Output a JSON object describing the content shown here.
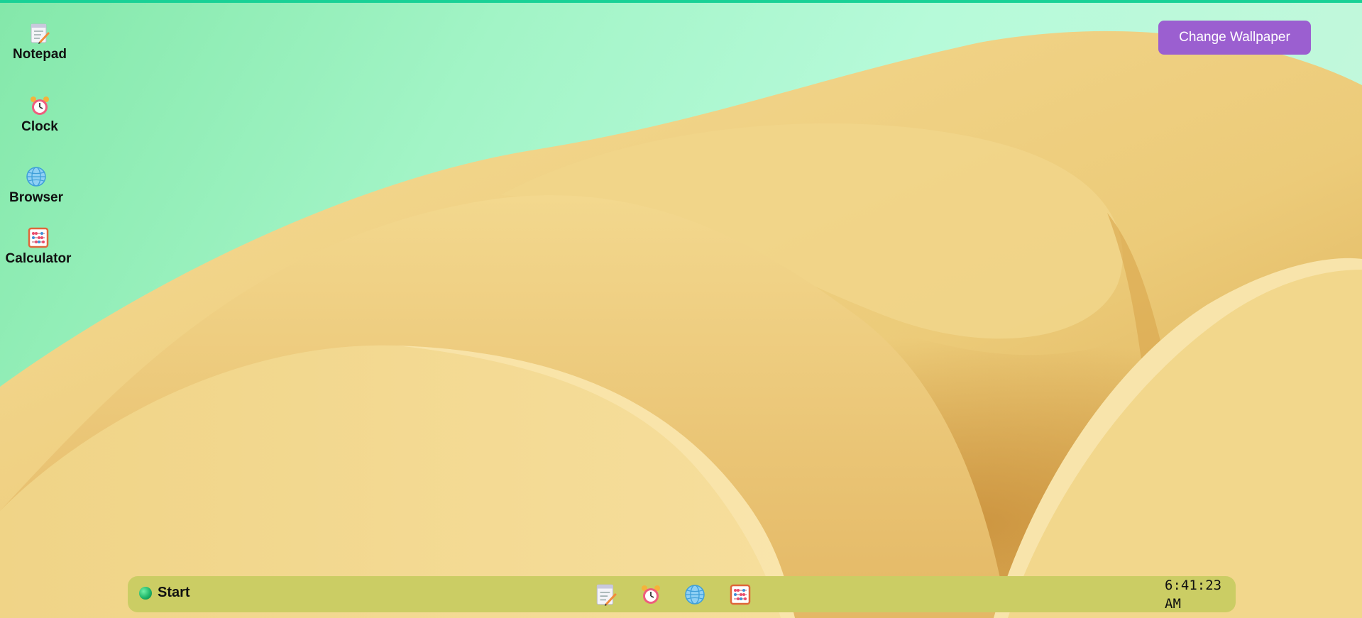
{
  "desktop": {
    "icons": [
      {
        "label": "Notepad",
        "icon": "notepad-icon"
      },
      {
        "label": "Clock",
        "icon": "alarm-clock-icon"
      },
      {
        "label": "Browser",
        "icon": "globe-icon"
      },
      {
        "label": "Calculator",
        "icon": "abacus-icon"
      }
    ]
  },
  "toolbar": {
    "change_wallpaper_label": "Change Wallpaper"
  },
  "taskbar": {
    "start_label": "Start",
    "apps": [
      {
        "icon": "notepad-icon"
      },
      {
        "icon": "alarm-clock-icon"
      },
      {
        "icon": "globe-icon"
      },
      {
        "icon": "abacus-icon"
      }
    ],
    "clock": "6:41:23\nAM"
  },
  "colors": {
    "accent": "#9b5fd0",
    "taskbar": "#cbcd64",
    "top_accent": "#19d196",
    "wallpaper_green": "#a2f4c6",
    "wallpaper_sand": "#efcf7e"
  }
}
